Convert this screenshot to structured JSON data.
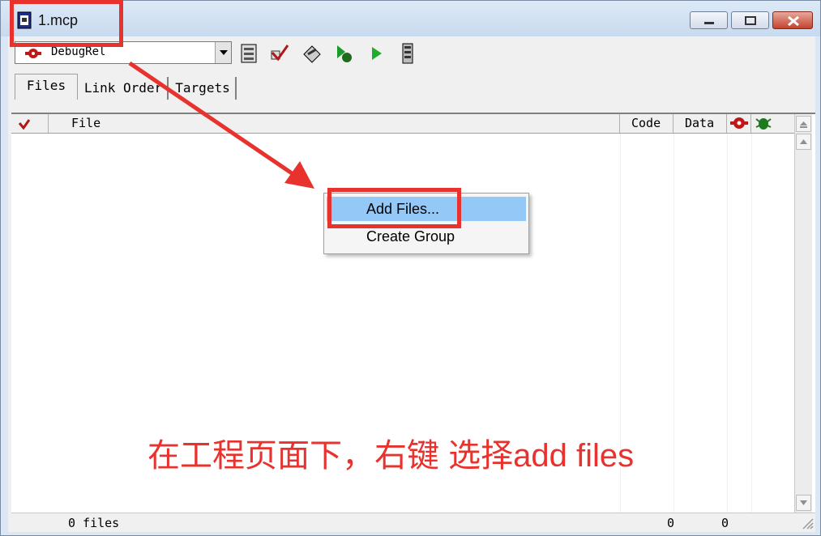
{
  "window": {
    "title": "1.mcp",
    "icon": "project-file-icon",
    "buttons": [
      "minimize-icon",
      "maximize-icon",
      "close-icon"
    ]
  },
  "toolbar": {
    "target_select": "DebugRel",
    "icons": [
      "target-settings-icon",
      "synchronize-icon",
      "make-icon",
      "debug-icon",
      "run-icon",
      "project-inspector-icon"
    ]
  },
  "tabs": [
    {
      "label": "Files",
      "active": true
    },
    {
      "label": "Link Order",
      "active": false
    },
    {
      "label": "Targets",
      "active": false
    }
  ],
  "file_list": {
    "columns": {
      "check_icon": "touch-check-icon",
      "file": "File",
      "code": "Code",
      "data": "Data",
      "debug_icon": "debug-column-icon",
      "bug_icon": "bug-column-icon"
    },
    "rows": []
  },
  "context_menu": {
    "items": [
      {
        "label": "Add Files...",
        "highlighted": true
      },
      {
        "label": "Create Group",
        "highlighted": false
      }
    ]
  },
  "status": {
    "files": "0 files",
    "code": "0",
    "data": "0"
  },
  "annotation": {
    "text": "在工程页面下，右键 选择add files",
    "color": "#e8322d"
  },
  "colors": {
    "highlight_red": "#e8322d",
    "menu_highlight": "#94c8f7",
    "titlebar": "#dce9f7"
  }
}
